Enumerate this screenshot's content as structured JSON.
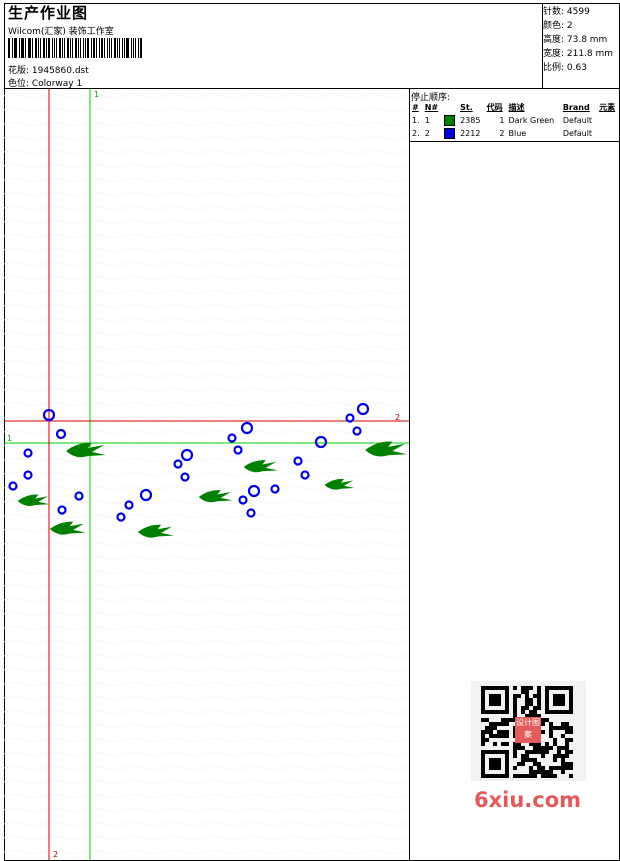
{
  "header": {
    "title": "生产作业图",
    "subtitle": "Wilcom(汇家) 装饰工作室",
    "design_label": "花版: 1945860.dst",
    "colorway_label": "色位: Colorway 1"
  },
  "stats": {
    "stitches": "针数: 4599",
    "colors": "颜色: 2",
    "height": "高度: 73.8 mm",
    "width": "宽度: 211.8 mm",
    "scale": "比例: 0.63"
  },
  "stop_sequence": {
    "title": "停止顺序:",
    "headers": [
      "#",
      "N#",
      "St.",
      "代码",
      "描述",
      "Brand",
      "元素"
    ],
    "rows": [
      {
        "num": "1.",
        "n": "1",
        "color": "#008000",
        "st": "2385",
        "code": "1",
        "desc": "Dark Green",
        "brand": "Default"
      },
      {
        "num": "2.",
        "n": "2",
        "color": "#0000e0",
        "st": "2212",
        "code": "2",
        "desc": "Blue",
        "brand": "Default"
      }
    ]
  },
  "guides": {
    "vertical_1": "1",
    "horizontal_1": "1",
    "vertical_2": "2",
    "horizontal_2": "2"
  },
  "colors": {
    "green_guide": "#00cc00",
    "red_guide": "#cc0000",
    "thread_green": "#008000",
    "thread_blue": "#0000e0"
  },
  "watermark": {
    "site": "6xiu.com",
    "stamp": "设计图案"
  }
}
